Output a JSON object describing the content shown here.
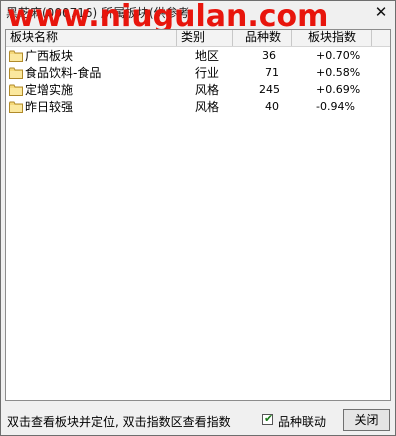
{
  "window": {
    "title": "黑芝麻(000716)  所属板块(供参考",
    "watermark": "www.niugulan.com",
    "close_glyph": "✕"
  },
  "table": {
    "columns": [
      "板块名称",
      "类别",
      "品种数",
      "板块指数"
    ],
    "rows": [
      {
        "name": "广西板块",
        "category": "地区",
        "count": "36",
        "index": "+0.70%"
      },
      {
        "name": "食品饮料-食品",
        "category": "行业",
        "count": "71",
        "index": "+0.58%"
      },
      {
        "name": "定增实施",
        "category": "风格",
        "count": "245",
        "index": "+0.69%"
      },
      {
        "name": "昨日较强",
        "category": "风格",
        "count": "40",
        "index": "-0.94%"
      }
    ]
  },
  "status": {
    "hint": "双击查看板块并定位, 双击指数区查看指数",
    "linkage_label": "品种联动",
    "linkage_checked": true,
    "close_label": "关闭"
  },
  "icons": {
    "folder": "folder-icon",
    "close": "close-icon",
    "check": "checkmark-icon"
  }
}
